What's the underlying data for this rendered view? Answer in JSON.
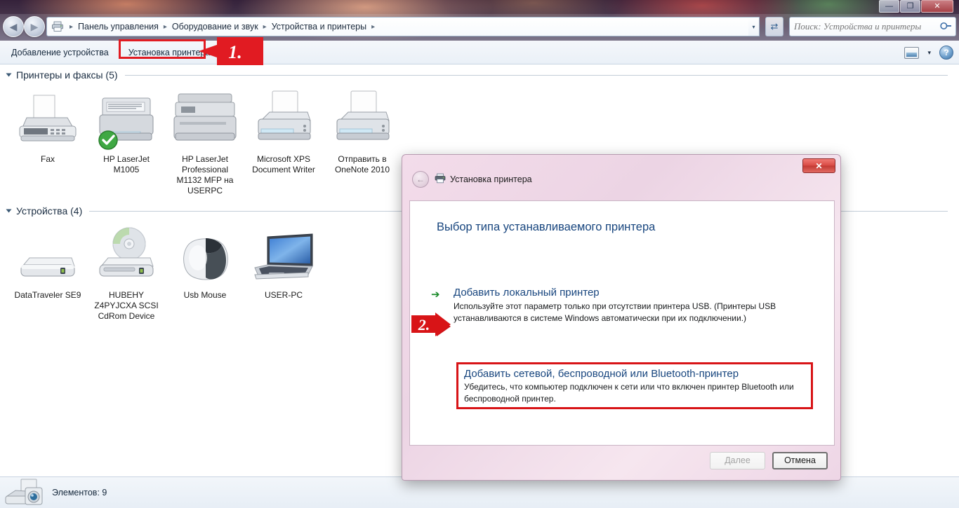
{
  "window": {
    "controls": {
      "minimize": "—",
      "maximize": "❐",
      "close": "✕"
    }
  },
  "address_bar": {
    "back_icon": "◀",
    "forward_icon": "▶",
    "history_caret": "▾",
    "breadcrumb_icon": "printer-icon",
    "crumbs": [
      "Панель управления",
      "Оборудование и звук",
      "Устройства и принтеры"
    ],
    "separator": "▸",
    "dropdown_caret": "▾",
    "refresh_icon": "⇄"
  },
  "search": {
    "placeholder": "Поиск: Устройства и принтеры",
    "value": "",
    "icon": "🔍"
  },
  "toolbar": {
    "add_device": "Добавление устройства",
    "add_printer": "Установка принтера",
    "view_caret": "▾",
    "help_glyph": "?"
  },
  "groups": [
    {
      "label": "Принтеры и факсы (5)",
      "items": [
        {
          "name": "Fax",
          "icon": "fax-icon",
          "badge": ""
        },
        {
          "name": "HP LaserJet\nM1005",
          "icon": "laser-printer-icon",
          "badge": "default-check"
        },
        {
          "name": "HP LaserJet\nProfessional\nM1132 MFP на\nUSERPC",
          "icon": "mfp-printer-icon",
          "badge": ""
        },
        {
          "name": "Microsoft XPS\nDocument Writer",
          "icon": "inkjet-printer-icon",
          "badge": ""
        },
        {
          "name": "Отправить в\nOneNote 2010",
          "icon": "inkjet-printer-icon",
          "badge": ""
        }
      ]
    },
    {
      "label": "Устройства (4)",
      "items": [
        {
          "name": "DataTraveler SE9",
          "icon": "usb-drive-icon",
          "badge": ""
        },
        {
          "name": "HUBEHY\nZ4PYJCXA SCSI\nCdRom Device",
          "icon": "cdrom-drive-icon",
          "badge": ""
        },
        {
          "name": "Usb Mouse",
          "icon": "mouse-icon",
          "badge": ""
        },
        {
          "name": "USER-PC",
          "icon": "laptop-icon",
          "badge": ""
        }
      ]
    }
  ],
  "statusbar": {
    "icon": "printer-camera-icon",
    "text": "Элементов: 9"
  },
  "dialog": {
    "titlebar": {
      "icon": "printer-icon",
      "title": "Установка принтера",
      "back_glyph": "←",
      "close_glyph": "✕"
    },
    "heading": "Выбор типа устанавливаемого принтера",
    "options": [
      {
        "arrow": "➔",
        "title": "Добавить локальный принтер",
        "description": "Используйте этот параметр только при отсутствии принтера USB. (Принтеры USB устанавливаются в системе Windows автоматически при их подключении.)"
      },
      {
        "title": "Добавить сетевой, беспроводной или Bluetooth-принтер",
        "description": "Убедитесь, что компьютер подключен к сети или что включен принтер Bluetooth или беспроводной принтер.",
        "highlighted": true
      }
    ],
    "buttons": {
      "next": "Далее",
      "cancel": "Отмена"
    }
  },
  "annotations": [
    {
      "id": "step-1",
      "label": "1.",
      "points_to": "Установка принтера"
    },
    {
      "id": "step-2",
      "label": "2.",
      "points_to": "Добавить сетевой, беспроводной или Bluetooth-принтер"
    }
  ],
  "colors": {
    "annotation_red": "#e11b22",
    "link_blue": "#17457e",
    "dialog_frame": "#eed6e6"
  }
}
